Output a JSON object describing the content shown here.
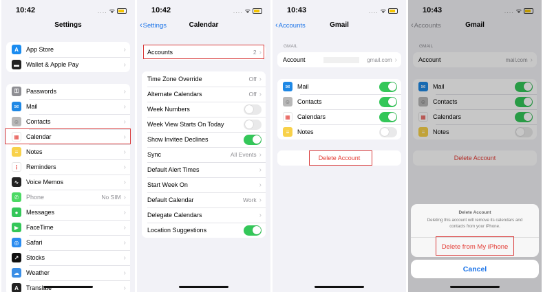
{
  "panels": [
    {
      "time": "10:42",
      "title": "Settings",
      "group1": [
        {
          "label": "App Store",
          "icon": "app-store-icon",
          "color": "#1a8cf0",
          "glyph": "A"
        },
        {
          "label": "Wallet & Apple Pay",
          "icon": "wallet-icon",
          "color": "#222222",
          "glyph": "▬"
        }
      ],
      "group2": [
        {
          "label": "Passwords",
          "icon": "key-icon",
          "color": "#8e8e93",
          "glyph": "⚿"
        },
        {
          "label": "Mail",
          "icon": "mail-icon",
          "color": "#1e88e5",
          "glyph": "✉"
        },
        {
          "label": "Contacts",
          "icon": "contacts-icon",
          "color": "#b8b8b8",
          "glyph": "☺"
        },
        {
          "label": "Calendar",
          "icon": "calendar-icon",
          "color": "#ffffff",
          "glyph": "▦"
        },
        {
          "label": "Notes",
          "icon": "notes-icon",
          "color": "#f8d14a",
          "glyph": "≡"
        },
        {
          "label": "Reminders",
          "icon": "reminders-icon",
          "color": "#ffffff",
          "glyph": "⋮"
        },
        {
          "label": "Voice Memos",
          "icon": "voice-memos-icon",
          "color": "#222222",
          "glyph": "∿"
        },
        {
          "label": "Phone",
          "icon": "phone-icon",
          "color": "#4cd964",
          "glyph": "✆",
          "value": "No SIM",
          "dim": true
        },
        {
          "label": "Messages",
          "icon": "messages-icon",
          "color": "#34c759",
          "glyph": "●"
        },
        {
          "label": "FaceTime",
          "icon": "facetime-icon",
          "color": "#34c759",
          "glyph": "▶"
        },
        {
          "label": "Safari",
          "icon": "safari-icon",
          "color": "#2a8cf0",
          "glyph": "◎"
        },
        {
          "label": "Stocks",
          "icon": "stocks-icon",
          "color": "#111111",
          "glyph": "↗"
        },
        {
          "label": "Weather",
          "icon": "weather-icon",
          "color": "#3a8ee6",
          "glyph": "☁"
        },
        {
          "label": "Translate",
          "icon": "translate-icon",
          "color": "#222222",
          "glyph": "A"
        }
      ]
    },
    {
      "time": "10:42",
      "back": "Settings",
      "title": "Calendar",
      "accounts": {
        "label": "Accounts",
        "value": "2"
      },
      "rows": [
        {
          "label": "Time Zone Override",
          "value": "Off",
          "kind": "chev"
        },
        {
          "label": "Alternate Calendars",
          "value": "Off",
          "kind": "chev"
        },
        {
          "label": "Week Numbers",
          "kind": "toggle",
          "on": false
        },
        {
          "label": "Week View Starts On Today",
          "kind": "toggle",
          "on": false
        },
        {
          "label": "Show Invitee Declines",
          "kind": "toggle",
          "on": true
        },
        {
          "label": "Sync",
          "value": "All Events",
          "kind": "chev"
        },
        {
          "label": "Default Alert Times",
          "kind": "chev"
        },
        {
          "label": "Start Week On",
          "kind": "chev"
        },
        {
          "label": "Default Calendar",
          "value": "Work",
          "kind": "chev"
        },
        {
          "label": "Delegate Calendars",
          "kind": "chev"
        },
        {
          "label": "Location Suggestions",
          "kind": "toggle",
          "on": true
        }
      ]
    },
    {
      "time": "10:43",
      "back": "Accounts",
      "title": "Gmail",
      "section": "GMAIL",
      "account_label": "Account",
      "account_value": "gmail.com",
      "services": [
        {
          "label": "Mail",
          "icon": "mail-icon",
          "color": "#1e88e5",
          "glyph": "✉",
          "on": true
        },
        {
          "label": "Contacts",
          "icon": "contacts-icon",
          "color": "#b8b8b8",
          "glyph": "☺",
          "on": true
        },
        {
          "label": "Calendars",
          "icon": "calendar-icon",
          "color": "#ffffff",
          "glyph": "▦",
          "on": true
        },
        {
          "label": "Notes",
          "icon": "notes-icon",
          "color": "#f8d14a",
          "glyph": "≡",
          "on": false
        }
      ],
      "delete_label": "Delete Account"
    },
    {
      "time": "10:43",
      "back": "Accounts",
      "title": "Gmail",
      "section": "GMAIL",
      "account_label": "Account",
      "account_value": "mail.com",
      "services": [
        {
          "label": "Mail",
          "icon": "mail-icon",
          "color": "#1e88e5",
          "glyph": "✉",
          "on": true
        },
        {
          "label": "Contacts",
          "icon": "contacts-icon",
          "color": "#b8b8b8",
          "glyph": "☺",
          "on": true
        },
        {
          "label": "Calendars",
          "icon": "calendar-icon",
          "color": "#ffffff",
          "glyph": "▦",
          "on": true
        },
        {
          "label": "Notes",
          "icon": "notes-icon",
          "color": "#f8d14a",
          "glyph": "≡",
          "on": false
        }
      ],
      "delete_label": "Delete Account",
      "sheet": {
        "title": "Delete Account",
        "message": "Deleting this account will remove its calendars and contacts from your iPhone.",
        "confirm": "Delete from My iPhone",
        "cancel": "Cancel"
      }
    }
  ],
  "status": {
    "dots": "....",
    "wifi": "ᯤ"
  }
}
